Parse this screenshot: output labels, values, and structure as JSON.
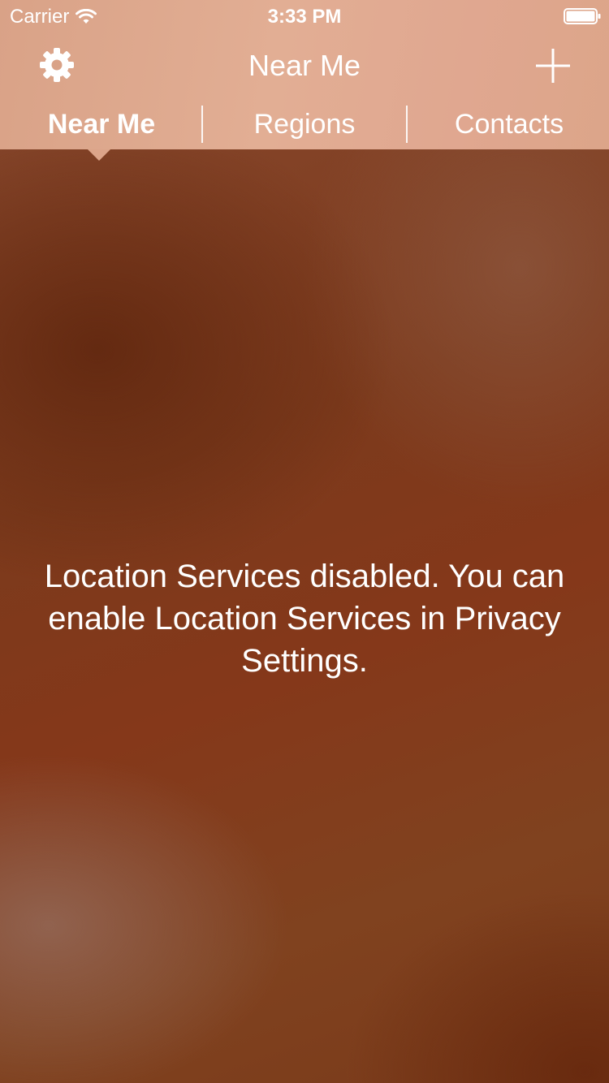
{
  "status_bar": {
    "carrier": "Carrier",
    "time": "3:33 PM",
    "icons": [
      "wifi-icon",
      "battery-icon"
    ]
  },
  "nav_bar": {
    "title": "Near Me",
    "left_icon": "gear-icon",
    "right_icon": "plus-icon"
  },
  "tabs": [
    {
      "label": "Near Me",
      "active": true
    },
    {
      "label": "Regions",
      "active": false
    },
    {
      "label": "Contacts",
      "active": false
    }
  ],
  "main": {
    "message": "Location Services disabled. You can enable Location Services in Privacy Settings."
  },
  "colors": {
    "header": "#e0a88e",
    "background": "#7c3a1c",
    "text": "#ffffff"
  }
}
